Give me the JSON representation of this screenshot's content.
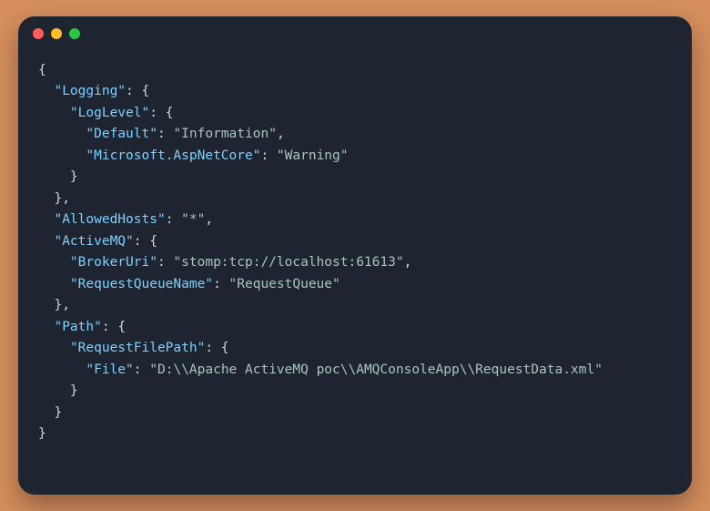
{
  "window": {
    "traffic_lights": [
      "close",
      "minimize",
      "zoom"
    ]
  },
  "code": {
    "lines": [
      [
        {
          "t": "pn",
          "v": "{"
        }
      ],
      [
        {
          "t": "pn",
          "v": "  "
        },
        {
          "t": "key",
          "v": "\"Logging\""
        },
        {
          "t": "pn",
          "v": ": {"
        }
      ],
      [
        {
          "t": "pn",
          "v": "    "
        },
        {
          "t": "key",
          "v": "\"LogLevel\""
        },
        {
          "t": "pn",
          "v": ": {"
        }
      ],
      [
        {
          "t": "pn",
          "v": "      "
        },
        {
          "t": "key",
          "v": "\"Default\""
        },
        {
          "t": "pn",
          "v": ": "
        },
        {
          "t": "str",
          "v": "\"Information\""
        },
        {
          "t": "pn",
          "v": ","
        }
      ],
      [
        {
          "t": "pn",
          "v": "      "
        },
        {
          "t": "key",
          "v": "\"Microsoft.AspNetCore\""
        },
        {
          "t": "pn",
          "v": ": "
        },
        {
          "t": "str",
          "v": "\"Warning\""
        }
      ],
      [
        {
          "t": "pn",
          "v": "    }"
        }
      ],
      [
        {
          "t": "pn",
          "v": "  },"
        }
      ],
      [
        {
          "t": "pn",
          "v": "  "
        },
        {
          "t": "key",
          "v": "\"AllowedHosts\""
        },
        {
          "t": "pn",
          "v": ": "
        },
        {
          "t": "str",
          "v": "\"*\""
        },
        {
          "t": "pn",
          "v": ","
        }
      ],
      [
        {
          "t": "pn",
          "v": "  "
        },
        {
          "t": "key",
          "v": "\"ActiveMQ\""
        },
        {
          "t": "pn",
          "v": ": {"
        }
      ],
      [
        {
          "t": "pn",
          "v": "    "
        },
        {
          "t": "key",
          "v": "\"BrokerUri\""
        },
        {
          "t": "pn",
          "v": ": "
        },
        {
          "t": "str",
          "v": "\"stomp:tcp://localhost:61613\""
        },
        {
          "t": "pn",
          "v": ","
        }
      ],
      [
        {
          "t": "pn",
          "v": "    "
        },
        {
          "t": "key",
          "v": "\"RequestQueueName\""
        },
        {
          "t": "pn",
          "v": ": "
        },
        {
          "t": "str",
          "v": "\"RequestQueue\""
        }
      ],
      [
        {
          "t": "pn",
          "v": "  },"
        }
      ],
      [
        {
          "t": "pn",
          "v": "  "
        },
        {
          "t": "key",
          "v": "\"Path\""
        },
        {
          "t": "pn",
          "v": ": {"
        }
      ],
      [
        {
          "t": "pn",
          "v": "    "
        },
        {
          "t": "key",
          "v": "\"RequestFilePath\""
        },
        {
          "t": "pn",
          "v": ": {"
        }
      ],
      [
        {
          "t": "pn",
          "v": "      "
        },
        {
          "t": "key",
          "v": "\"File\""
        },
        {
          "t": "pn",
          "v": ": "
        },
        {
          "t": "str",
          "v": "\"D:\\\\Apache ActiveMQ poc\\\\AMQConsoleApp\\\\RequestData.xml\""
        }
      ],
      [
        {
          "t": "pn",
          "v": "    }"
        }
      ],
      [
        {
          "t": "pn",
          "v": "  }"
        }
      ],
      [
        {
          "t": "pn",
          "v": "}"
        }
      ]
    ]
  }
}
